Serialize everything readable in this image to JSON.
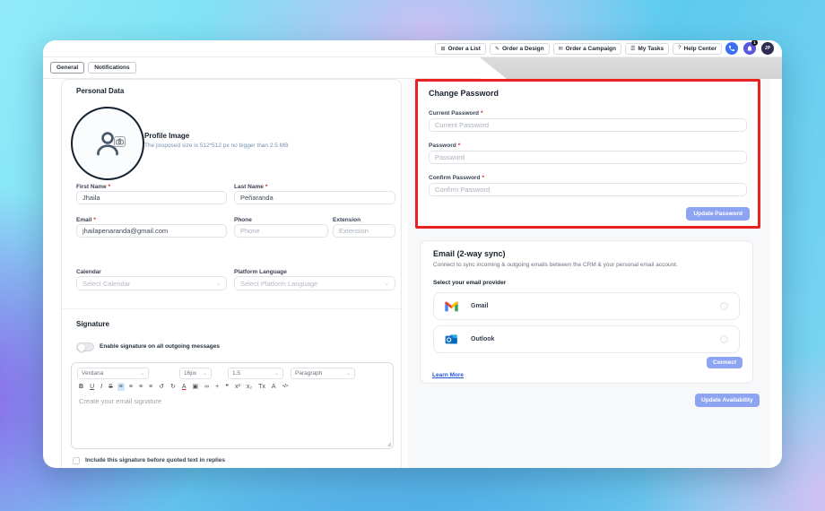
{
  "required_mark": "*",
  "colors": {
    "accent_red": "#e8221f",
    "action_blue": "#8da4f2",
    "link_blue": "#2456d9"
  },
  "topbar": {
    "buttons": [
      {
        "label": "Order a List",
        "glyph": "⊞"
      },
      {
        "label": "Order a Design",
        "glyph": "✎"
      },
      {
        "label": "Order a Campaign",
        "glyph": "✉"
      },
      {
        "label": "My Tasks",
        "glyph": "☰"
      },
      {
        "label": "Help Center",
        "glyph": "?"
      }
    ],
    "notification_badge": "1",
    "avatar_initials": "JP"
  },
  "tabs": [
    {
      "label": "General"
    },
    {
      "label": "Notifications"
    }
  ],
  "personal_data": {
    "title": "Personal Data",
    "profile_image": {
      "title": "Profile Image",
      "hint": "The proposed size is 512*512 px no bigger than 2.5 MB"
    },
    "fields": {
      "first_name": {
        "label": "First Name",
        "value": "Jhaila"
      },
      "last_name": {
        "label": "Last Name",
        "value": "Peñaranda"
      },
      "email": {
        "label": "Email",
        "value": "jhailapenaranda@gmail.com"
      },
      "phone": {
        "label": "Phone",
        "placeholder": "Phone"
      },
      "extension": {
        "label": "Extension",
        "placeholder": "Extension"
      },
      "calendar": {
        "label": "Calendar",
        "placeholder": "Select Calendar"
      },
      "platform_language": {
        "label": "Platform Language",
        "placeholder": "Select Platform Language"
      }
    }
  },
  "signature": {
    "title": "Signature",
    "toggle_label": "Enable signature on all outgoing messages",
    "toolbar": {
      "font": "Verdana",
      "size": "16px",
      "line_height": "1.5",
      "block": "Paragraph",
      "icons": [
        {
          "name": "bold",
          "glyph": "B"
        },
        {
          "name": "underline",
          "glyph": "U"
        },
        {
          "name": "italic",
          "glyph": "I"
        },
        {
          "name": "strikethrough",
          "glyph": "S"
        },
        {
          "name": "align-left",
          "glyph": "≡",
          "active": true
        },
        {
          "name": "align-center",
          "glyph": "≡"
        },
        {
          "name": "align-right",
          "glyph": "≡"
        },
        {
          "name": "align-justify",
          "glyph": "≡"
        },
        {
          "name": "undo",
          "glyph": "↺"
        },
        {
          "name": "redo",
          "glyph": "↻"
        },
        {
          "name": "text-color",
          "glyph": "A"
        },
        {
          "name": "image",
          "glyph": "▣"
        },
        {
          "name": "link",
          "glyph": "∞"
        },
        {
          "name": "insert",
          "glyph": "+"
        },
        {
          "name": "blockquote",
          "glyph": "❝"
        },
        {
          "name": "superscript",
          "glyph": "x²"
        },
        {
          "name": "subscript",
          "glyph": "x₂"
        },
        {
          "name": "clear-format",
          "glyph": "Tx"
        },
        {
          "name": "highlight",
          "glyph": "A"
        },
        {
          "name": "code",
          "glyph": "</>"
        }
      ]
    },
    "editor_placeholder": "Create your email signature",
    "checkbox_label": "Include this signature before quoted text in replies"
  },
  "change_password": {
    "title": "Change Password",
    "fields": [
      {
        "label": "Current Password",
        "placeholder": "Current Password"
      },
      {
        "label": "Password",
        "placeholder": "Password"
      },
      {
        "label": "Confirm Password",
        "placeholder": "Confirm Password"
      }
    ],
    "submit_label": "Update Password"
  },
  "email_sync": {
    "title": "Email (2-way sync)",
    "description": "Connect to sync incoming & outgoing emails between the CRM & your personal email account.",
    "provider_label": "Select your email provider",
    "providers": [
      {
        "name": "Gmail"
      },
      {
        "name": "Outlook"
      }
    ],
    "connect_label": "Connect",
    "learn_more_label": "Learn More"
  },
  "availability": {
    "submit_label": "Update Availability"
  }
}
